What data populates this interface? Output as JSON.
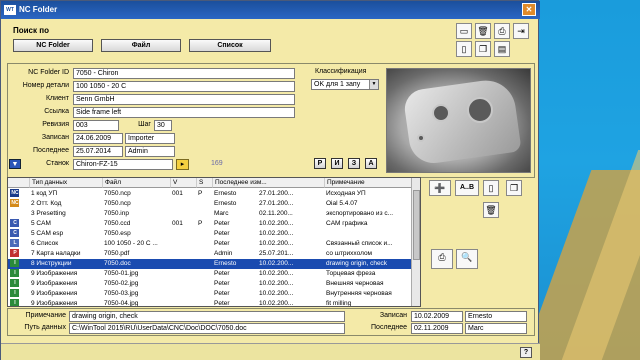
{
  "window": {
    "title": "NC Folder",
    "app_icon": "WT",
    "close_label": "✕"
  },
  "search": {
    "label": "Поиск по",
    "buttons": [
      "NC Folder",
      "Файл",
      "Список"
    ]
  },
  "form": {
    "nc_folder_id_label": "NC Folder ID",
    "nc_folder_id": "7050 - Chiron",
    "part_no_label": "Номер детали",
    "part_no": "100 1050 - 20 С",
    "client_label": "Клиент",
    "client": "Senn GmbH",
    "link_label": "Ссылка",
    "link": "Side frame left",
    "revision_label": "Ревизия",
    "revision": "003",
    "step_label": "Шаг",
    "step": "30",
    "written_label": "Записан",
    "written_date": "24.06.2009",
    "written_by": "Importer",
    "last_label": "Последнее",
    "last_date": "25.07.2014",
    "last_by": "Admin",
    "machine_label": "Станок",
    "machine": "Chiron-FZ-15",
    "count": "169",
    "class_label": "Классификация",
    "class_value": "OK для 1 запу",
    "small_buttons": [
      "P",
      "И",
      "З",
      "A"
    ]
  },
  "table": {
    "headers": [
      "Тип данных",
      "Файл",
      "V",
      "S",
      "Последнее изм...",
      "Примечание"
    ],
    "rows": [
      {
        "icon": "NC",
        "icon_color": "#1a3a8a",
        "type": "1 код УП",
        "file": "7050.ncp",
        "v": "001",
        "s": "P",
        "who": "Ernesto",
        "date": "27.01.200...",
        "note": "Исходная УП"
      },
      {
        "icon": "NC",
        "icon_color": "#d48a1a",
        "type": "2 Отт. Код",
        "file": "7050.ncp",
        "v": "",
        "s": "",
        "who": "Ernesto",
        "date": "27.01.200...",
        "note": "Oial 5.4.07"
      },
      {
        "icon": "",
        "icon_color": "#ffffff",
        "type": "3 Presetting",
        "file": "7050.inp",
        "v": "",
        "s": "",
        "who": "Marc",
        "date": "02.11.200...",
        "note": "экспортировано из с..."
      },
      {
        "icon": "C",
        "icon_color": "#3a5ab0",
        "type": "5 CAM",
        "file": "7050.ccd",
        "v": "001",
        "s": "P",
        "who": "Peter",
        "date": "10.02.200...",
        "note": "CAM графика"
      },
      {
        "icon": "C",
        "icon_color": "#3a5ab0",
        "type": "5 CAM esp",
        "file": "7050.esp",
        "v": "",
        "s": "",
        "who": "Peter",
        "date": "10.02.200...",
        "note": ""
      },
      {
        "icon": "L",
        "icon_color": "#4a6ab8",
        "type": "6 Список",
        "file": "100 1050 - 20 С ...",
        "v": "",
        "s": "",
        "who": "Peter",
        "date": "10.02.200...",
        "note": "Связанный список и..."
      },
      {
        "icon": "P",
        "icon_color": "#c03030",
        "type": "7 Карта наладки",
        "file": "7050.pdf",
        "v": "",
        "s": "",
        "who": "Admin",
        "date": "25.07.201...",
        "note": "со штриххолом"
      },
      {
        "icon": "I",
        "icon_color": "#2a8a3a",
        "type": "8 Инструкции",
        "file": "7050.doc",
        "v": "",
        "s": "",
        "who": "Ernesto",
        "date": "10.02.200...",
        "note": "drawing origin, check"
      },
      {
        "icon": "I",
        "icon_color": "#2a8a3a",
        "type": "9 Изображения",
        "file": "7050-01.jpg",
        "v": "",
        "s": "",
        "who": "Peter",
        "date": "10.02.200...",
        "note": "Торцевая фреза"
      },
      {
        "icon": "I",
        "icon_color": "#2a8a3a",
        "type": "9 Изображения",
        "file": "7050-02.jpg",
        "v": "",
        "s": "",
        "who": "Peter",
        "date": "10.02.200...",
        "note": "Внешняя черновая"
      },
      {
        "icon": "I",
        "icon_color": "#2a8a3a",
        "type": "9 Изображения",
        "file": "7050-03.jpg",
        "v": "",
        "s": "",
        "who": "Peter",
        "date": "10.02.200...",
        "note": "Внутренняя черновая"
      },
      {
        "icon": "I",
        "icon_color": "#2a8a3a",
        "type": "9 Изображения",
        "file": "7050-04.jpg",
        "v": "",
        "s": "",
        "who": "Peter",
        "date": "10.02.200...",
        "note": "fit milling"
      }
    ],
    "selected_index": 7
  },
  "bottom": {
    "note_label": "Примечание",
    "note": "drawing origin, check",
    "path_label": "Путь данных",
    "path": "C:\\WinTool 2015\\RU\\UserData\\CNC\\Doc\\DOC\\7050.doc",
    "written_label": "Записан",
    "written_date": "10.02.2009",
    "written_by": "Ernesto",
    "last_label": "Последнее",
    "last_date": "02.11.2009",
    "last_by": "Marc"
  },
  "side_buttons": {
    "abc": "A..B"
  },
  "status": {
    "help": "?"
  }
}
